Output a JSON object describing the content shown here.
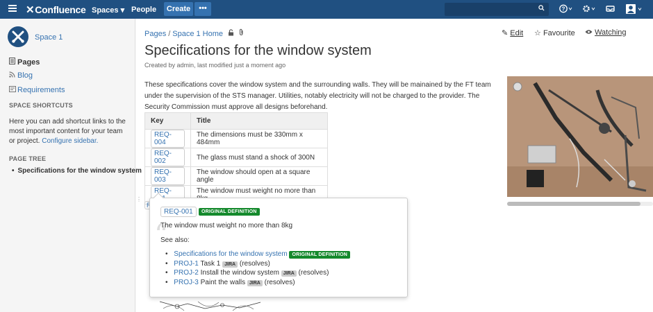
{
  "topnav": {
    "brand": "Confluence",
    "spaces": "Spaces ▾",
    "people": "People",
    "create": "Create",
    "more": "•••",
    "icons": [
      "menu-icon",
      "search-icon",
      "help-icon",
      "settings-icon",
      "notifications-icon",
      "user-avatar-icon"
    ]
  },
  "sidebar": {
    "space_name": "Space 1",
    "items": [
      {
        "label": "Pages",
        "icon": "pages-icon"
      },
      {
        "label": "Blog",
        "icon": "blog-icon"
      },
      {
        "label": "Requirements",
        "icon": "requirements-icon"
      }
    ],
    "shortcuts_heading": "SPACE SHORTCUTS",
    "shortcuts_text": "Here you can add shortcut links to the most important content for your team or project.",
    "configure_link": "Configure sidebar.",
    "tree_heading": "PAGE TREE",
    "tree_item": "Specifications for the window system"
  },
  "breadcrumb": {
    "pages": "Pages",
    "sep": "/",
    "home": "Space 1 Home"
  },
  "actions": {
    "edit": "Edit",
    "favourite": "Favourite",
    "watching": "Watching"
  },
  "page": {
    "title": "Specifications for the window system",
    "byline": "Created by admin, last modified just a moment ago",
    "intro": "These specifications cover the window system and the surrounding walls. They will be mainained by the FT team under the supervision of the STS manager. Utilities, notably electricity will not be charged to the provider. The Security Commission must approve all designs beforehand."
  },
  "table": {
    "headers": [
      "Key",
      "Title"
    ],
    "rows": [
      {
        "key": "REQ-004",
        "title": "The dimensions must be 330mm x 484mm"
      },
      {
        "key": "REQ-002",
        "title": "The glass must stand a shock of 300N"
      },
      {
        "key": "REQ-003",
        "title": "The window should open at a square angle"
      },
      {
        "key": "REQ-001",
        "title": "The window must weight no more than 8kg"
      }
    ],
    "peek": "R"
  },
  "popup": {
    "key": "REQ-001",
    "badge": "ORIGINAL DEFINITION",
    "description": "The window must weight no more than 8kg",
    "see_also": "See also:",
    "links": [
      {
        "link": "Specifications for the window system",
        "rest": "",
        "badge": "ORIGINAL DEFINITION",
        "jira": "",
        "suffix": ""
      },
      {
        "link": "PROJ-1",
        "rest": " Task 1 ",
        "badge": "",
        "jira": "JIRA",
        "suffix": " (resolves)"
      },
      {
        "link": "PROJ-2",
        "rest": " Install the window system ",
        "badge": "",
        "jira": "JIRA",
        "suffix": " (resolves)"
      },
      {
        "link": "PROJ-3",
        "rest": " Paint the walls ",
        "badge": "",
        "jira": "JIRA",
        "suffix": " (resolves)"
      }
    ]
  },
  "colors": {
    "nav": "#205081",
    "link": "#3572b0",
    "badge_green": "#14892c",
    "sidebar": "#f5f5f5"
  }
}
